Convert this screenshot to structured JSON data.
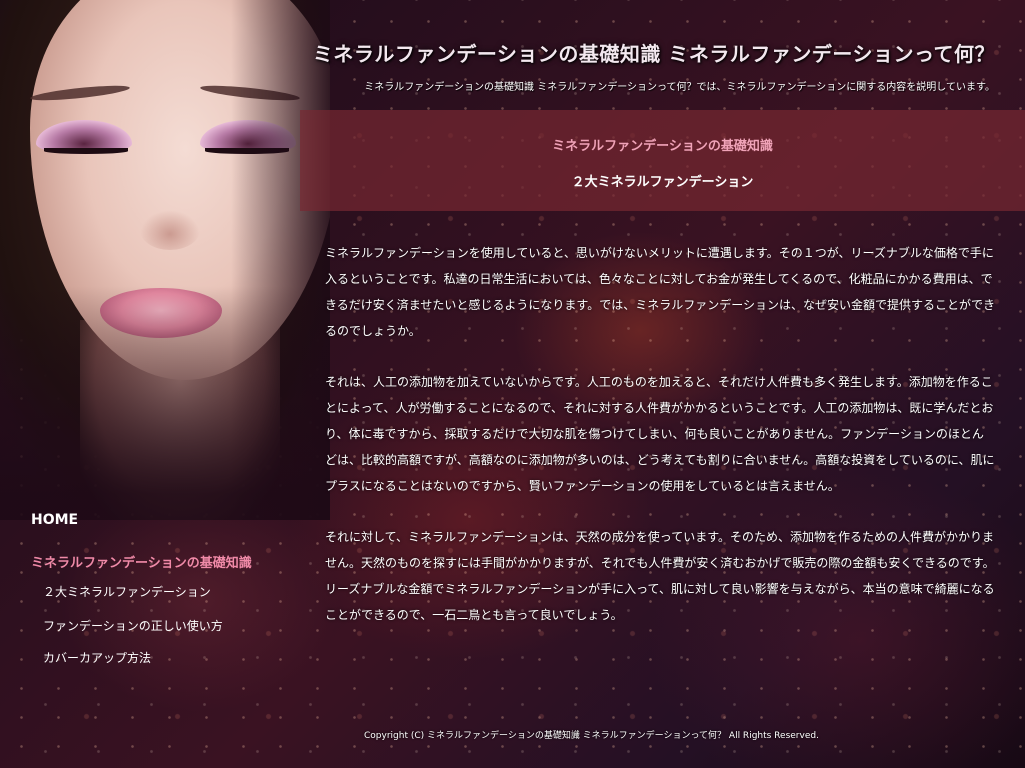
{
  "header": {
    "site_title": "ミネラルファンデーションの基礎知識 ミネラルファンデーションって何？",
    "site_description": "ミネラルファンデーションの基礎知識 ミネラルファンデーションって何？では、ミネラルファンデーションに関する内容を説明しています。"
  },
  "page": {
    "category": "ミネラルファンデーションの基礎知識",
    "heading": "２大ミネラルファンデーション"
  },
  "article": {
    "paragraphs": [
      "ミネラルファンデーションを使用していると、思いがけないメリットに遭遇します。その１つが、リーズナブルな価格で手に入るということです。私達の日常生活においては、色々なことに対してお金が発生してくるので、化粧品にかかる費用は、できるだけ安く済ませたいと感じるようになります。では、ミネラルファンデーションは、なぜ安い金額で提供することができるのでしょうか。",
      "それは、人工の添加物を加えていないからです。人工のものを加えると、それだけ人件費も多く発生します。添加物を作ることによって、人が労働することになるので、それに対する人件費がかかるということです。人工の添加物は、既に学んだとおり、体に毒ですから、採取するだけで大切な肌を傷つけてしまい、何も良いことがありません。ファンデーションのほとんどは、比較的高額ですが、高額なのに添加物が多いのは、どう考えても割りに合いません。高額な投資をしているのに、肌にプラスになることはないのですから、賢いファンデーションの使用をしているとは言えません。",
      "それに対して、ミネラルファンデーションは、天然の成分を使っています。そのため、添加物を作るための人件費がかかりません。天然のものを探すには手間がかかりますが、それでも人件費が安く済むおかげで販売の際の金額も安くできるのです。リーズナブルな金額でミネラルファンデーションが手に入って、肌に対して良い影響を与えながら、本当の意味で綺麗になることができるので、一石二鳥とも言って良いでしょう。"
    ]
  },
  "nav": {
    "home": "HOME",
    "category": "ミネラルファンデーションの基礎知識",
    "items": [
      "２大ミネラルファンデーション",
      "ファンデーションの正しい使い方",
      "カバーカアップ方法"
    ]
  },
  "footer": {
    "copyright": "Copyright (C) ミネラルファンデーションの基礎知識 ミネラルファンデーションって何？ All Rights Reserved."
  }
}
